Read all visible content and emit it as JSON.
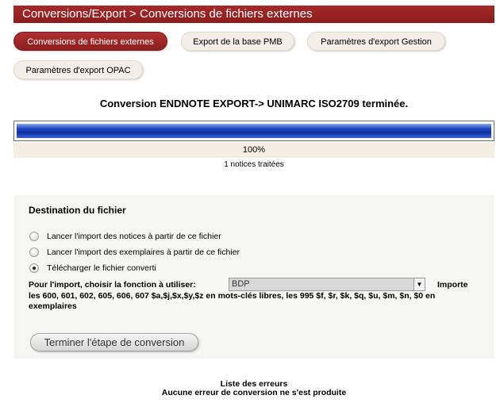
{
  "header": {
    "title": "Conversions/Export > Conversions de fichiers externes"
  },
  "tabs": [
    {
      "label": "Conversions de fichiers externes",
      "active": true
    },
    {
      "label": "Export de la base PMB",
      "active": false
    },
    {
      "label": "Paramètres d'export Gestion",
      "active": false
    },
    {
      "label": "Paramètres d'export OPAC",
      "active": false
    }
  ],
  "conversion": {
    "status_title": "Conversion ENDNOTE EXPORT-> UNIMARC ISO2709 terminée.",
    "progress_percent": 100,
    "progress_label": "100%",
    "notices_processed": "1 notices traitées"
  },
  "destination": {
    "title": "Destination du fichier",
    "options": [
      {
        "label": "Lancer l'import des notices à partir de ce fichier",
        "checked": false
      },
      {
        "label": "Lancer l'import des exemplaires à partir de ce fichier",
        "checked": false
      },
      {
        "label": "Télécharger le fichier converti",
        "checked": true
      }
    ],
    "function_label": "Pour l'import, choisir la fonction à utiliser:",
    "function_value": "BDP",
    "importe_label": "Importe",
    "import_description": "les 600, 601, 602, 605, 606, 607 $a,$j,$x,$y,$z en mots-clés libres, les 995 $f, $r, $k, $q, $u, $m, $n, $0 en exemplaires",
    "finish_button": "Terminer l'étape de conversion"
  },
  "errors": {
    "title": "Liste des erreurs",
    "message": "Aucune erreur de conversion ne s'est produite"
  },
  "colors": {
    "header_bg": "#9b2424",
    "active_tab": "#a02a2a",
    "progress_bar": "#1a47c8",
    "panel_bg": "#f5f5f4"
  }
}
